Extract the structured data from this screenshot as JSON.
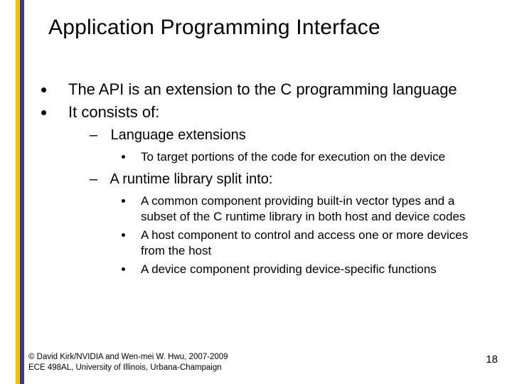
{
  "title": "Application Programming Interface",
  "bullets": {
    "b1": "The API is an extension to the C programming language",
    "b2": "It consists of:",
    "sub1": "Language extensions",
    "sub1_a": "To target portions of the code for execution on the device",
    "sub2": "A runtime library split into:",
    "sub2_a": "A common component providing built-in vector types and a subset of the C runtime library in both host and device codes",
    "sub2_b": "A host component to control and access one or more devices from the host",
    "sub2_c": "A device component providing device-specific functions"
  },
  "footer": {
    "line1": "© David Kirk/NVIDIA and Wen-mei W. Hwu, 2007-2009",
    "line2": "ECE 498AL, University of Illinois, Urbana-Champaign"
  },
  "page_number": "18"
}
